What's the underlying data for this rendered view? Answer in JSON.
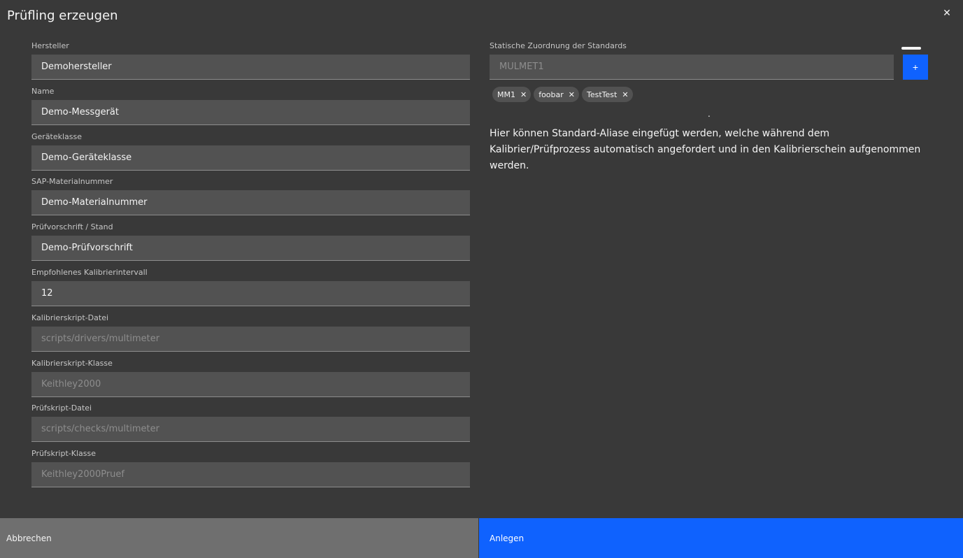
{
  "modal": {
    "title": "Prüfling erzeugen",
    "close_icon": "close-icon",
    "close_glyph": "✕"
  },
  "form": {
    "fields": [
      {
        "label": "Hersteller",
        "value": "Demohersteller",
        "enabled": true
      },
      {
        "label": "Name",
        "value": "Demo-Messgerät",
        "enabled": true
      },
      {
        "label": "Geräteklasse",
        "value": "Demo-Geräteklasse",
        "enabled": true
      },
      {
        "label": "SAP-Materialnummer",
        "value": "Demo-Materialnummer",
        "enabled": true
      },
      {
        "label": "Prüfvorschrift / Stand",
        "value": "Demo-Prüfvorschrift",
        "enabled": true
      },
      {
        "label": "Empfohlenes Kalibrierintervall",
        "value": "12",
        "enabled": true
      },
      {
        "label": "Kalibrierskript-Datei",
        "value": "scripts/drivers/multimeter",
        "enabled": false
      },
      {
        "label": "Kalibrierskript-Klasse",
        "value": "Keithley2000",
        "enabled": false
      },
      {
        "label": "Prüfskript-Datei",
        "value": "scripts/checks/multimeter",
        "enabled": false
      },
      {
        "label": "Prüfskript-Klasse",
        "value": "Keithley2000Pruef",
        "enabled": false
      }
    ]
  },
  "standards": {
    "label": "Statische Zuordnung der Standards",
    "placeholder": "MULMET1",
    "add_label": "+",
    "tags": [
      "MM1",
      "foobar",
      "TestTest"
    ],
    "tag_remove_glyph": "✕",
    "dot": ".",
    "helper": "Hier können Standard-Aliase eingefügt werden, welche während dem Kalibrier/Prüfprozess automatisch angefordert und in den Kalibrierschein aufgenommen werden."
  },
  "footer": {
    "cancel_label": "Abbrechen",
    "create_label": "Anlegen"
  },
  "colors": {
    "background": "#393939",
    "input": "#525252",
    "primary": "#0f62fe",
    "secondary": "#6f6f6f"
  }
}
